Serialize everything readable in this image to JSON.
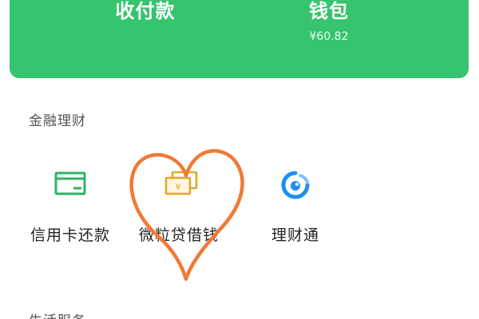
{
  "header": {
    "pay_label": "收付款",
    "wallet_label": "钱包",
    "wallet_balance": "¥60.82"
  },
  "finance_section": {
    "title": "金融理财",
    "items": [
      {
        "label": "信用卡还款",
        "icon": "credit-card-icon"
      },
      {
        "label": "微粒贷借钱",
        "icon": "money-stack-icon"
      },
      {
        "label": "理财通",
        "icon": "wealth-management-icon"
      }
    ]
  },
  "next_section": {
    "title": "生活服务"
  },
  "colors": {
    "brand_green": "#36c46e",
    "icon_green": "#2fb36a",
    "icon_gold": "#e6a623",
    "icon_blue": "#1e8ff0",
    "heart_orange": "#f07a35"
  }
}
